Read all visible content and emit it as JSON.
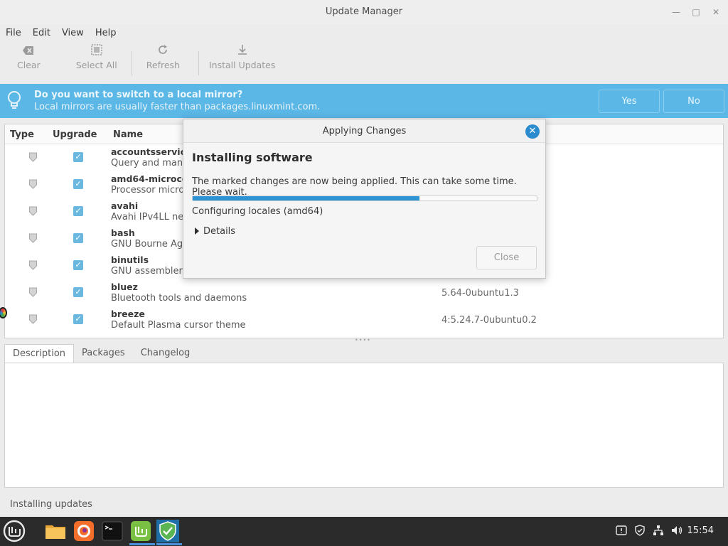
{
  "window": {
    "title": "Update Manager"
  },
  "menu": [
    "File",
    "Edit",
    "View",
    "Help"
  ],
  "toolbar": {
    "clear": "Clear",
    "select_all": "Select All",
    "refresh": "Refresh",
    "install_updates": "Install Updates"
  },
  "infobar": {
    "question": "Do you want to switch to a local mirror?",
    "subtext": "Local mirrors are usually faster than packages.linuxmint.com.",
    "yes": "Yes",
    "no": "No",
    "color": "#5bb7e6"
  },
  "list": {
    "columns": {
      "type": "Type",
      "upgrade": "Upgrade",
      "name": "Name"
    },
    "rows": [
      {
        "name": "accountsservice",
        "desc": "Query and manip",
        "version": ""
      },
      {
        "name": "amd64-microcode",
        "desc": "Processor microc",
        "version": ""
      },
      {
        "name": "avahi",
        "desc": "Avahi IPv4LL net",
        "version": ""
      },
      {
        "name": "bash",
        "desc": "GNU Bourne Aga",
        "version": ""
      },
      {
        "name": "binutils",
        "desc": "GNU assembler, l",
        "version": ""
      },
      {
        "name": "bluez",
        "desc": "Bluetooth tools and daemons",
        "version": "5.64-0ubuntu1.3"
      },
      {
        "name": "breeze",
        "desc": "Default Plasma cursor theme",
        "version": "4:5.24.7-0ubuntu0.2"
      }
    ]
  },
  "tabs": [
    "Description",
    "Packages",
    "Changelog"
  ],
  "status": "Installing updates",
  "dialog": {
    "title": "Applying Changes",
    "heading": "Installing software",
    "message": "The marked changes are now being applied. This can take some time. Please wait.",
    "progress": 0.66,
    "status": "Configuring locales (amd64)",
    "details": "Details",
    "close": "Close",
    "accent": "#2d93d2"
  },
  "taskbar": {
    "clock": "15:54",
    "apps": [
      "menu-icon",
      "files-icon",
      "firefox-icon",
      "terminal-icon",
      "mintupdate-icon",
      "update-shield-icon"
    ]
  }
}
